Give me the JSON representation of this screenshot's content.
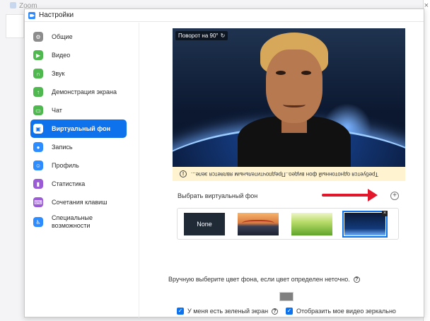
{
  "background_app": {
    "title": "Zoom"
  },
  "window": {
    "title": "Настройки"
  },
  "sidebar": {
    "items": [
      {
        "label": "Общие",
        "icon": "gear-icon",
        "color": "#8c8c8c"
      },
      {
        "label": "Видео",
        "icon": "video-icon",
        "color": "#4fb94f"
      },
      {
        "label": "Звук",
        "icon": "headphones-icon",
        "color": "#4fb94f"
      },
      {
        "label": "Демонстрация экрана",
        "icon": "share-screen-icon",
        "color": "#4fb94f"
      },
      {
        "label": "Чат",
        "icon": "chat-icon",
        "color": "#4fb94f"
      },
      {
        "label": "Виртуальный фон",
        "icon": "virtual-background-icon",
        "color": "#0e72ed",
        "active": true
      },
      {
        "label": "Запись",
        "icon": "record-icon",
        "color": "#2d8cff"
      },
      {
        "label": "Профиль",
        "icon": "profile-icon",
        "color": "#2d8cff"
      },
      {
        "label": "Статистика",
        "icon": "statistics-icon",
        "color": "#9b5bd6"
      },
      {
        "label": "Сочетания клавиш",
        "icon": "keyboard-icon",
        "color": "#9b5bd6"
      },
      {
        "label": "Специальные возможности",
        "icon": "accessibility-icon",
        "color": "#2d8cff"
      }
    ]
  },
  "preview": {
    "rotate_label": "Поворот на 90°",
    "warning": "Требуется однотонный фон видео..Предпочтительным является зеле..."
  },
  "choose": {
    "label": "Выбрать виртуальный фон",
    "add_icon": "plus-circle-icon"
  },
  "thumbnails": [
    {
      "label": "None"
    },
    {
      "name": "bridge"
    },
    {
      "name": "grass"
    },
    {
      "name": "earth",
      "selected": true
    }
  ],
  "manual": {
    "text": "Вручную выберите цвет фона, если цвет определен неточно.",
    "swatch_color": "#808080"
  },
  "checkboxes": [
    {
      "label": "У меня есть зеленый экран",
      "checked": true
    },
    {
      "label": "Отобразить мое видео зеркально",
      "checked": true
    }
  ],
  "colors": {
    "accent": "#0e72ed",
    "arrow": "#e2172b",
    "warning_bg": "#fff4cf"
  }
}
